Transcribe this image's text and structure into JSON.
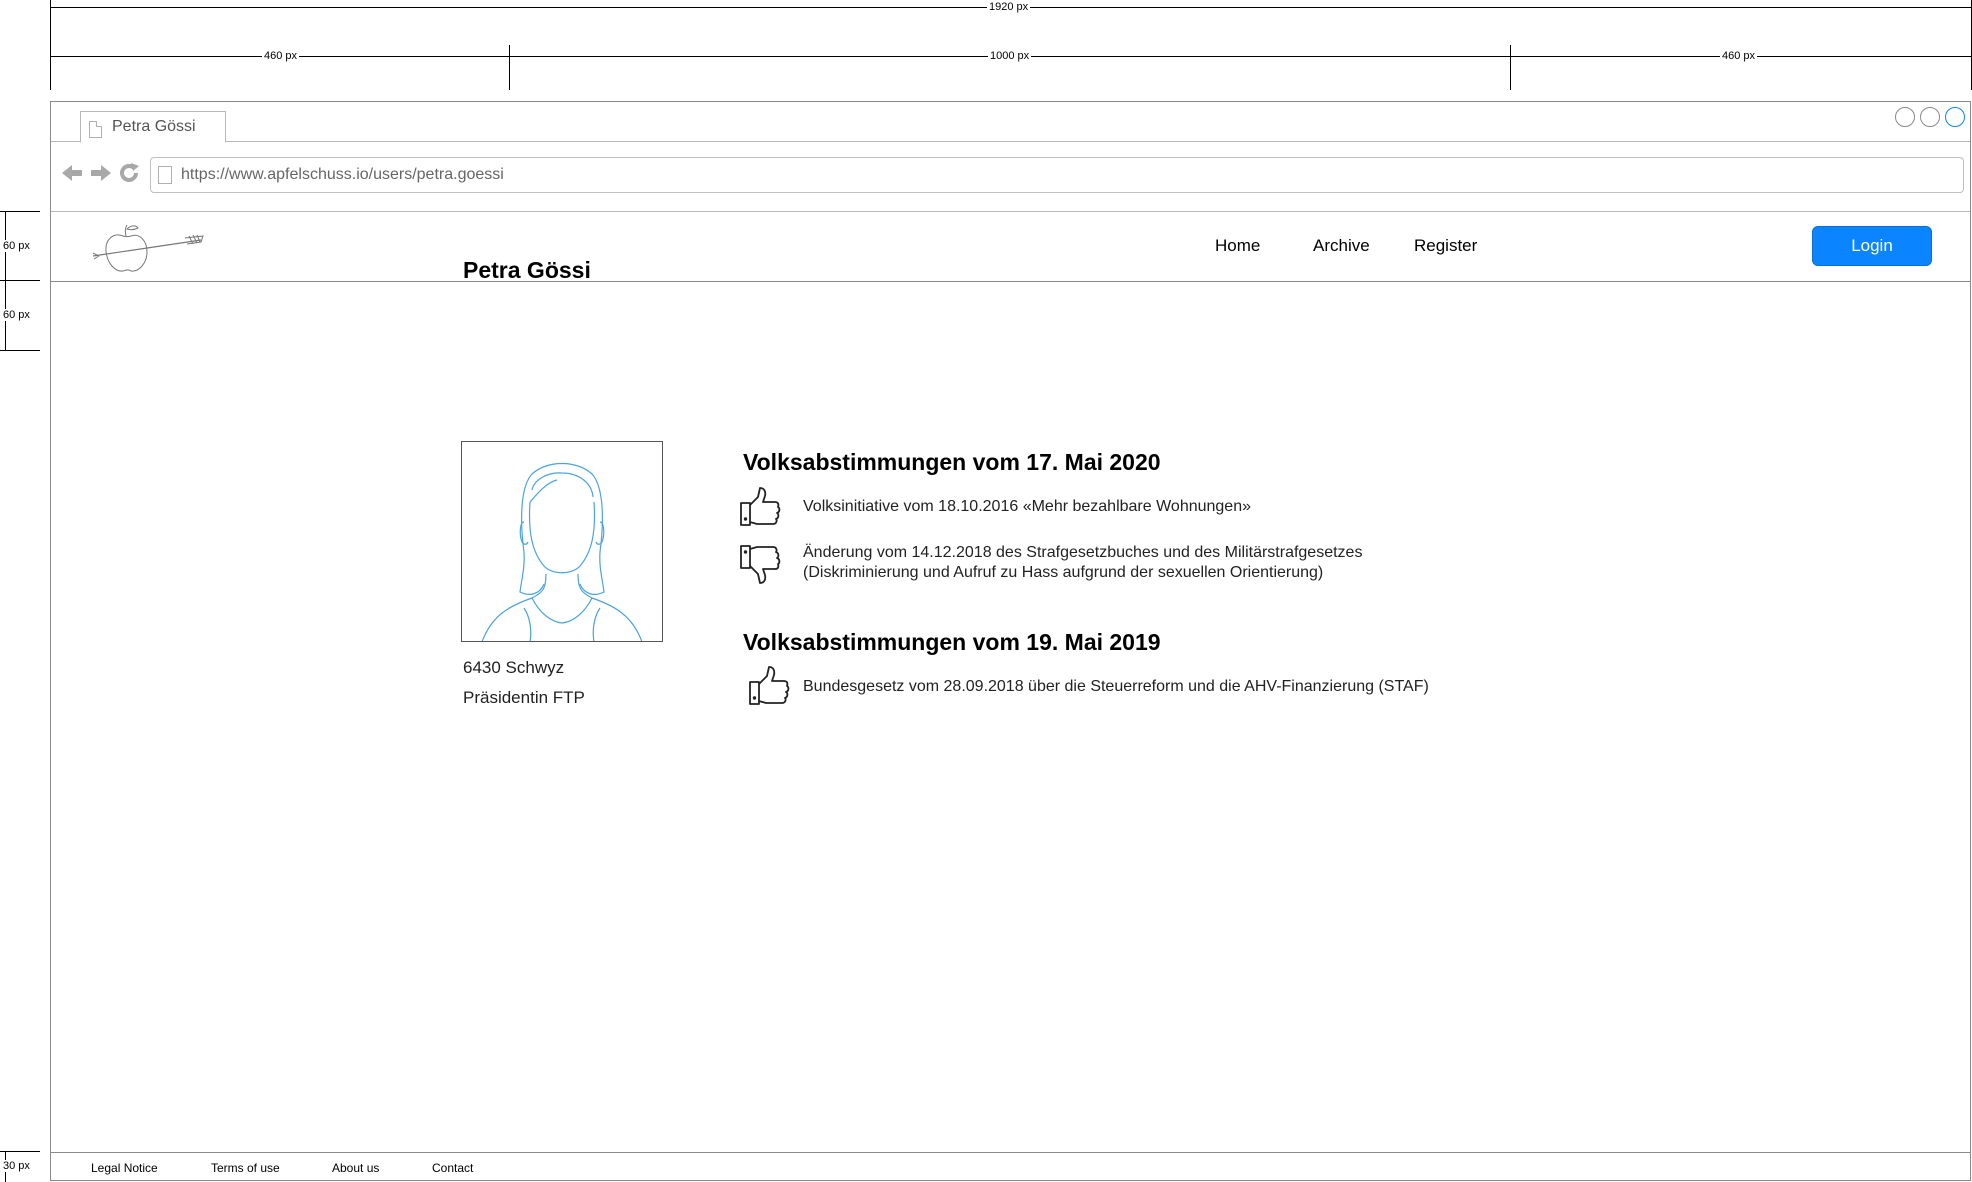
{
  "annotations": {
    "total_width": "1920 px",
    "left_margin": "460 px",
    "content_width": "1000 px",
    "right_margin": "460 px",
    "header_height": "60 px",
    "spacer_height": "60 px",
    "footer_height": "30 px"
  },
  "browser": {
    "tab_title": "Petra Gössi",
    "url": "https://www.apfelschuss.io/users/petra.goessi"
  },
  "header": {
    "logo_icon": "apple-arrow-logo",
    "nav": [
      "Home",
      "Archive",
      "Register"
    ],
    "login_label": "Login",
    "accent_color": "#0a84ff"
  },
  "profile": {
    "name": "Petra Gössi",
    "location": "6430 Schwyz",
    "role": "Präsidentin FTP"
  },
  "votes": [
    {
      "heading": "Volksabstimmungen vom 17. Mai 2020",
      "items": [
        {
          "vote": "thumbs-up",
          "text": "Volksinitiative vom 18.10.2016 «Mehr bezahlbare Wohnungen»"
        },
        {
          "vote": "thumbs-down",
          "text_line1": "Änderung vom 14.12.2018 des Strafgesetzbuches und des Militärstrafgesetzes",
          "text_line2": "(Diskriminierung und Aufruf zu Hass aufgrund der sexuellen Orientierung)"
        }
      ]
    },
    {
      "heading": "Volksabstimmungen vom 19. Mai 2019",
      "items": [
        {
          "vote": "thumbs-up",
          "text": "Bundesgesetz vom 28.09.2018 über die Steuerreform und die AHV-Finanzierung (STAF)"
        }
      ]
    }
  ],
  "footer": {
    "links": [
      "Legal Notice",
      "Terms of use",
      "About us",
      "Contact"
    ]
  }
}
